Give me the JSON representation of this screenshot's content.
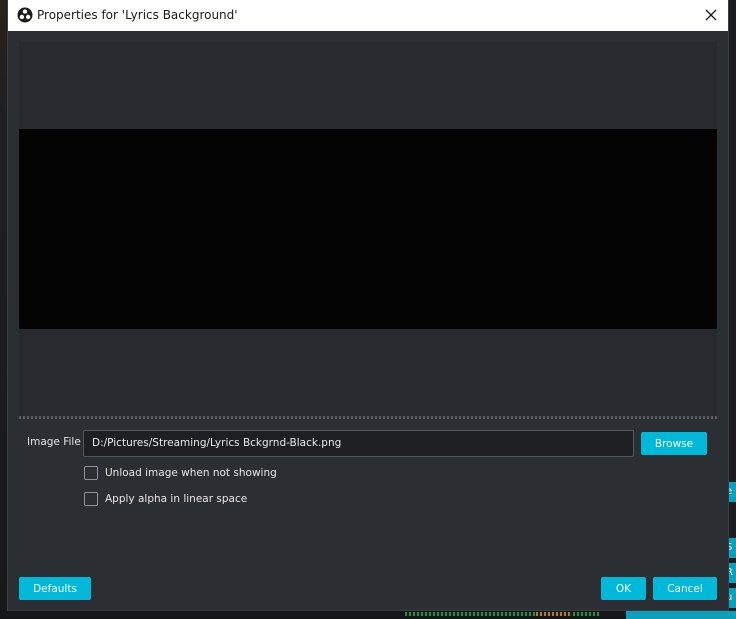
{
  "window": {
    "title": "Properties for 'Lyrics Background'"
  },
  "icons": {
    "app": "obs-logo-icon",
    "close": "close-icon"
  },
  "image_file": {
    "label": "Image File",
    "value": "D:/Pictures/Streaming/Lyrics Bckgrnd-Black.png",
    "browse_label": "Browse"
  },
  "options": [
    {
      "label": "Unload image when not showing",
      "checked": false
    },
    {
      "label": "Apply alpha in linear space",
      "checked": false
    }
  ],
  "footer": {
    "defaults_label": "Defaults",
    "ok_label": "OK",
    "cancel_label": "Cancel"
  },
  "background": {
    "tab_fragments": [
      "e",
      "S",
      "R",
      "u"
    ]
  },
  "colors": {
    "accent": "#00b8d8",
    "dialog_bg": "#2b2e33",
    "preview_bg": "#272a2e",
    "preview_image": "#040404"
  }
}
